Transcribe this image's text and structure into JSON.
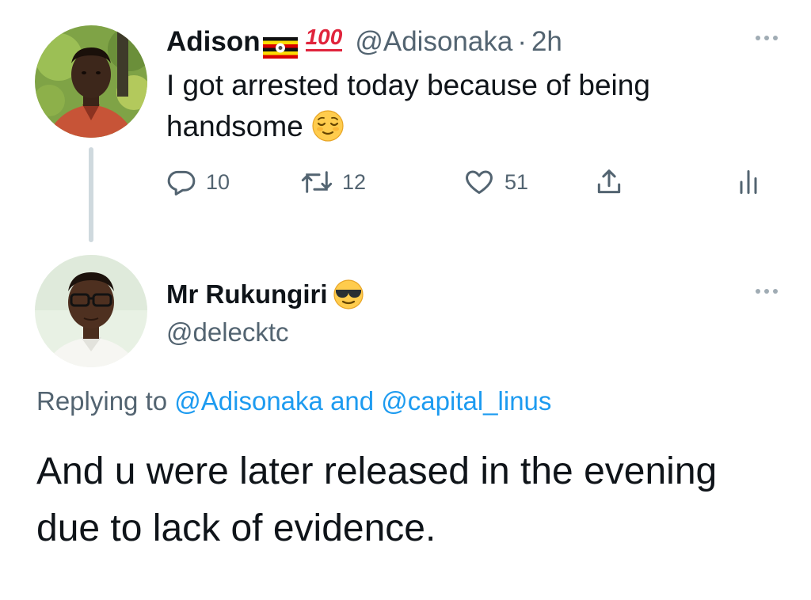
{
  "tweet1": {
    "author_name": "Adison",
    "flag_icon": "uganda-flag-icon",
    "hundred_emoji": "100",
    "handle": "@Adisonaka",
    "separator": "·",
    "timestamp": "2h",
    "text": "I got arrested today because of being handsome",
    "text_emoji": "relieved-face-emoji",
    "actions": {
      "reply_count": "10",
      "retweet_count": "12",
      "like_count": "51"
    }
  },
  "tweet2": {
    "author_name": "Mr Rukungiri",
    "name_emoji": "sunglasses-face-emoji",
    "handle": "@delecktc",
    "replying_prefix": "Replying to",
    "replying_user1": "@Adisonaka",
    "replying_and": "and",
    "replying_user2": "@capital_linus",
    "text": "And u were later released in the evening due to lack of evidence."
  },
  "colors": {
    "text_primary": "#0f1419",
    "text_secondary": "#536471",
    "link": "#1d9bf0",
    "thread_line": "#cfd9de"
  }
}
